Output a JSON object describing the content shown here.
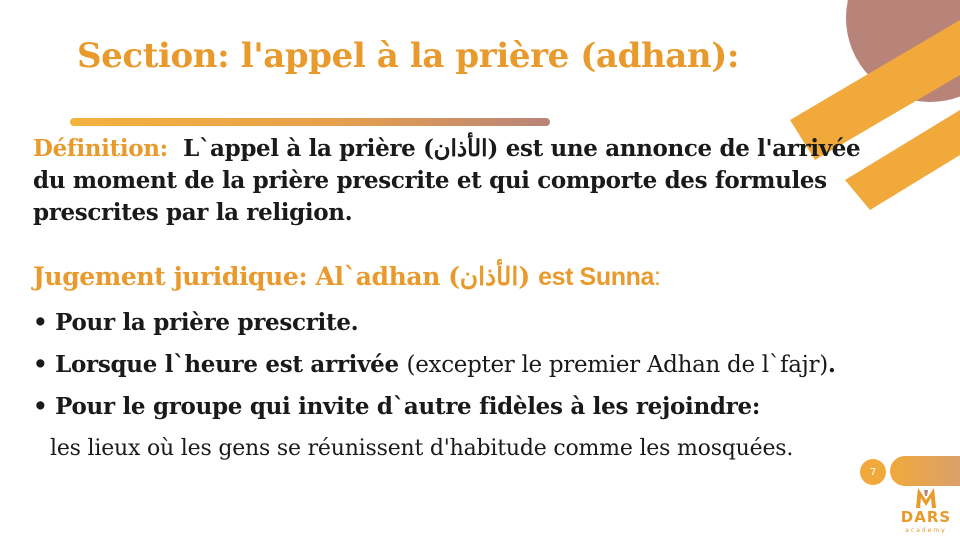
{
  "slide": {
    "title": "Section: l'appel à la prière (adhan):",
    "page_number": "7",
    "colors": {
      "accent": "#E99A2C",
      "brown": "#B8847A",
      "text": "#1a1a1a"
    }
  },
  "definition": {
    "label": "Définition:",
    "line1": "L`appel à la prière (الأذان) est une annonce de l'arrivée",
    "line2": "du moment de la prière prescrite et qui comporte des formules",
    "line3": "prescrites par la religion."
  },
  "judgement": {
    "label": "Jugement juridique: Al`adhan (الأذان)",
    "value": "est Sunna",
    "colon": ":"
  },
  "bullets": [
    {
      "bold": "Pour la prière prescrite.",
      "normal": ""
    },
    {
      "bold": "Lorsque l`heure est arrivée",
      "normal": "(excepter le premier Adhan de l`fajr)",
      "end": "."
    },
    {
      "bold": "Pour le groupe qui invite d`autre fidèles à les rejoindre:",
      "normal": ""
    }
  ],
  "places": "les lieux  où les gens se réunissent d'habitude comme les mosquées.",
  "logo": {
    "name": "DARS",
    "subtitle": "academy",
    "icon": "dars-logo-icon"
  }
}
